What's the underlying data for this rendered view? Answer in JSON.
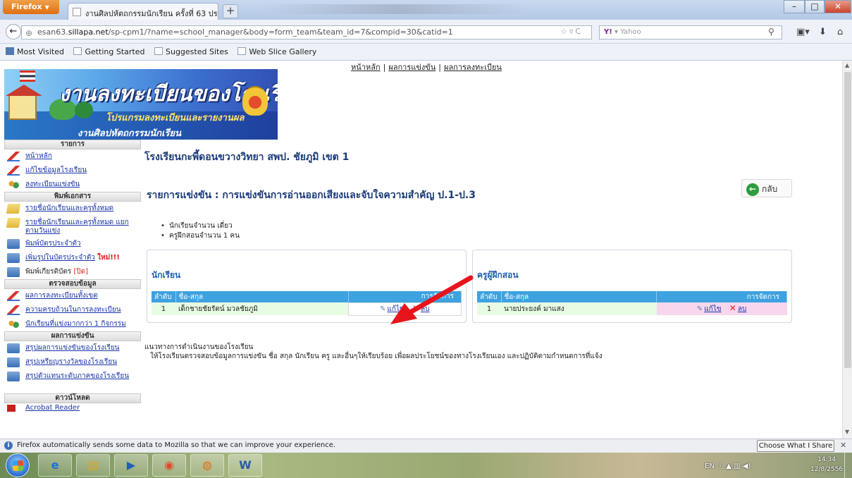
{
  "browser": {
    "menu_button": "Firefox",
    "tab_title": "งานศิลปหัตถกรรมนักเรียน ครั้งที่ 63 ประจำปี...",
    "url_prefix": "esan63.",
    "url_domain": "sillapa.net",
    "url_path": "/sp-cpm1/?name=school_manager&body=form_team&team_id=7&compid=30&catid=1",
    "search_placeholder": "Yahoo",
    "bookmarks": [
      "Most Visited",
      "Getting Started",
      "Suggested Sites",
      "Web Slice Gallery"
    ]
  },
  "page": {
    "top_menu": [
      "หน้าหลัก",
      "ผลการแข่งขัน",
      "ผลการลงทะเบียน"
    ],
    "banner": {
      "title": "งานลงทะเบียนของโรงเรียน",
      "subtitle_1": "โปรแกรมลงทะเบียนและรายงานผล",
      "subtitle_2": "งานศิลปหัตถกรรมนักเรียน"
    },
    "sidebar": {
      "section_menu": "รายการ",
      "menu_items": [
        "หน้าหลัก",
        "แก้ไขข้อมูลโรงเรียน",
        "ลงทะเบียนแข่งขัน"
      ],
      "section_print": "พิมพ์เอกสาร",
      "print_items": [
        "รายชื่อนักเรียนและครูทั้งหมด",
        "รายชื่อนักเรียนและครูทั้งหมด แยกตามวันแข่ง",
        "พิมพ์บัตรประจำตัว",
        "เพิ่มรูปในบัตรประจำตัว",
        "พิมพ์เกียรติบัตร"
      ],
      "new_badge": "ใหม่!!!",
      "closed_badge": "[ปิด]",
      "section_check": "ตรวจสอบข้อมูล",
      "check_items": [
        "ผลการลงทะเบียนทั้งเขต",
        "ความครบถ้วนในการลงทะเบียน",
        "นักเรียนที่แข่งมากกว่า 1 กิจกรรม"
      ],
      "section_results": "ผลการแข่งขัน",
      "result_items": [
        "สรุปผลการแข่งขันของโรงเรียน",
        "สรุปเหรียญรางวัลของโรงเรียน",
        "สรุปตัวแทนระดับภาคของโรงเรียน"
      ],
      "section_download": "ดาวน์โหลด",
      "download_items": [
        "Acrobat Reader"
      ]
    },
    "school_name": "โรงเรียนกะพี้ดอนขวางวิทยา สพป. ชัยภูมิ เขต 1",
    "contest_title": "รายการแข่งขัน : การแข่งขันการอ่านออกเสียงและจับใจความสำคัญ ป.1-ป.3",
    "back_label": "กลับ",
    "info": [
      "นักเรียนจำนวน เดี่ยว",
      "ครูฝึกสอนจำนวน 1 คน"
    ],
    "students_panel": {
      "title": "นักเรียน",
      "headers": [
        "ลำดับ",
        "ชื่อ-สกุล",
        "การจัดการ"
      ],
      "rows": [
        {
          "no": "1",
          "name": "เด็กชายชัยรัตน์  มวลชัยภูมิ"
        }
      ],
      "edit_label": "แก้ไข",
      "delete_label": "ลบ"
    },
    "teachers_panel": {
      "title": "ครูผู้ฝึกสอน",
      "headers": [
        "ลำดับ",
        "ชื่อ-สกุล",
        "การจัดการ"
      ],
      "rows": [
        {
          "no": "1",
          "name": "นายประยงค์  มาแสง"
        }
      ],
      "edit_label": "แก้ไข",
      "delete_label": "ลบ"
    },
    "guide_title": "แนวทางการดำเนินงานของโรงเรียน",
    "guide_text": "ให้โรงเรียนตรวจสอบข้อมูลการแข่งขัน ชื่อ สกุล นักเรียน ครู และอื่นๆให้เรียบร้อย เพื่อผลประโยชน์ของทางโรงเรียนเอง และปฏิบัติตามกำหนดการที่แจ้ง"
  },
  "notification": {
    "text": "Firefox automatically sends some data to Mozilla so that we can improve your experience.",
    "button": "Choose What I Share"
  },
  "taskbar": {
    "lang": "EN",
    "time": "14:34",
    "date": "12/8/2556"
  },
  "colors": {
    "link": "#1a35a8",
    "header_blue": "#3ea2e0",
    "heading": "#1a3a78",
    "annotation_arrow": "#e8141c"
  }
}
